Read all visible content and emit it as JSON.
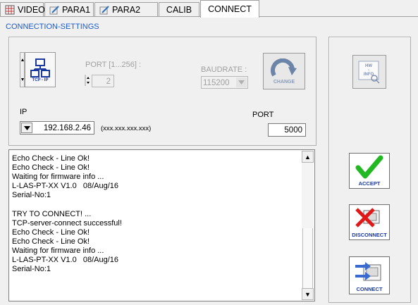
{
  "tabs": [
    {
      "label": "VIDEO",
      "icon": "video-grid-icon",
      "active": false
    },
    {
      "label": "PARA1",
      "icon": "pencil-icon",
      "active": false
    },
    {
      "label": "PARA2",
      "icon": "pencil-icon",
      "active": false
    },
    {
      "label": "CALIB",
      "icon": "",
      "active": false
    },
    {
      "label": "CONNECT",
      "icon": "",
      "active": true
    }
  ],
  "section_title": "CONNECTION-SETTINGS",
  "connection": {
    "interface_label": "TCP - IP",
    "port_range_label": "PORT [1...256] :",
    "port_range_value": "2",
    "baudrate_label": "BAUDRATE :",
    "baudrate_value": "115200",
    "change_label": "CHANGE",
    "ip_label": "IP",
    "ip_value": "192.168.2.46",
    "ip_format": "(xxx.xxx.xxx.xxx)",
    "port_label": "PORT",
    "port_value": "5000"
  },
  "log_lines": "Echo Check - Line Ok!\nEcho Check - Line Ok!\nWaiting for firmware info ...\nL-LAS-PT-XX V1.0   08/Aug/16\nSerial-No:1\n\nTRY TO CONNECT! ...\nTCP-server-connect successful!\nEcho Check - Line Ok!\nEcho Check - Line Ok!\nWaiting for firmware info ...\nL-LAS-PT-XX V1.0   08/Aug/16\nSerial-No:1",
  "hw_info": {
    "line1": "HW",
    "line2": "-",
    "line3": "INFO"
  },
  "buttons": {
    "accept": "ACCEPT",
    "disconnect": "DISCONNECT",
    "connect": "CONNECT"
  },
  "colors": {
    "accent": "#1a5ccf",
    "check": "#22b822",
    "cross": "#e01818",
    "icon_blue": "#1a3aa0"
  }
}
